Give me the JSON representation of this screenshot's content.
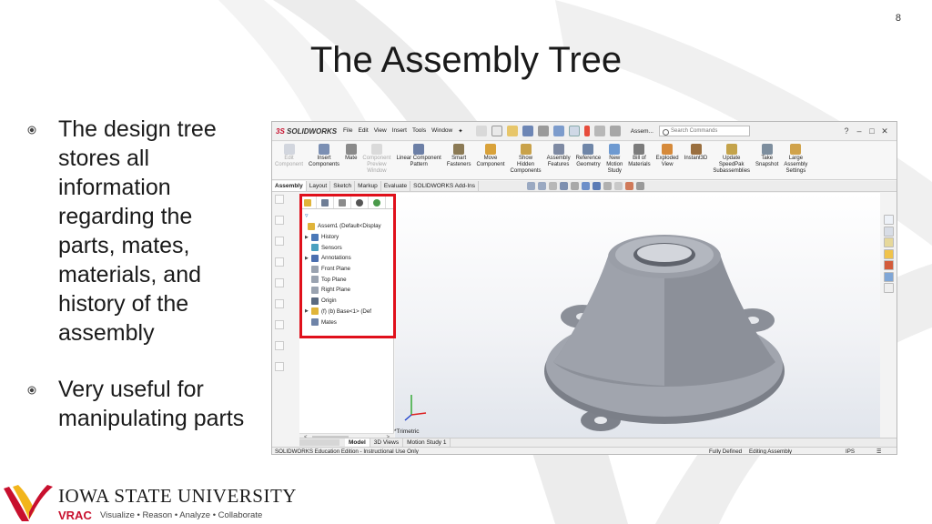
{
  "slide": {
    "page_number": "8",
    "title": "The Assembly Tree",
    "bullets": [
      "The design tree stores all information regarding the parts, mates, materials, and history of the assembly",
      "Very useful for manipulating parts"
    ]
  },
  "logo": {
    "university": "IOWA STATE UNIVERSITY",
    "lab": "VRAC",
    "tagline": "Visualize • Reason • Analyze • Collaborate"
  },
  "solidworks": {
    "brand_prefix": "3S",
    "brand": "SOLIDWORKS",
    "menu": [
      "File",
      "Edit",
      "View",
      "Insert",
      "Tools",
      "Window"
    ],
    "document_name": "Assem...",
    "search_placeholder": "Search Commands",
    "ribbon": [
      {
        "label": "Edit\nComponent",
        "dim": true,
        "color": "#9aa6b8"
      },
      {
        "label": "Insert\nComponents",
        "dim": false,
        "color": "#7b8fb3"
      },
      {
        "label": "Mate",
        "dim": false,
        "color": "#8a8a8a"
      },
      {
        "label": "Component\nPreview\nWindow",
        "dim": true,
        "color": "#b0b0b0"
      },
      {
        "label": "Linear Component\nPattern",
        "dim": false,
        "color": "#6c7fa6"
      },
      {
        "label": "Smart\nFasteners",
        "dim": false,
        "color": "#8b7a55"
      },
      {
        "label": "Move\nComponent",
        "dim": false,
        "color": "#d9a23a"
      },
      {
        "label": "Show\nHidden\nComponents",
        "dim": false,
        "color": "#c9a24a"
      },
      {
        "label": "Assembly\nFeatures",
        "dim": false,
        "color": "#7e8aa3"
      },
      {
        "label": "Reference\nGeometry",
        "dim": false,
        "color": "#6f86a8"
      },
      {
        "label": "New\nMotion\nStudy",
        "dim": false,
        "color": "#6e9ad1"
      },
      {
        "label": "Bill of\nMaterials",
        "dim": false,
        "color": "#7c7c7c"
      },
      {
        "label": "Exploded\nView",
        "dim": false,
        "color": "#d68a3a"
      },
      {
        "label": "Instant3D",
        "dim": false,
        "color": "#9a6f3f"
      },
      {
        "label": "Update\nSpeedPak\nSubassemblies",
        "dim": false,
        "color": "#c4a34a"
      },
      {
        "label": "Take\nSnapshot",
        "dim": false,
        "color": "#7d8e9e"
      },
      {
        "label": "Large\nAssembly\nSettings",
        "dim": false,
        "color": "#d0a24a"
      }
    ],
    "command_tabs": [
      "Assembly",
      "Layout",
      "Sketch",
      "Markup",
      "Evaluate",
      "SOLIDWORKS Add-Ins"
    ],
    "active_command_tab": "Assembly",
    "feature_tree": [
      {
        "arrow": "",
        "icon_color": "#e0b43a",
        "label": "Assem1  (Default<Display"
      },
      {
        "arrow": "▶",
        "icon_color": "#4a78b8",
        "label": "History"
      },
      {
        "arrow": "",
        "icon_color": "#4aa0c0",
        "label": "Sensors"
      },
      {
        "arrow": "▶",
        "icon_color": "#4a6fb0",
        "label": "Annotations"
      },
      {
        "arrow": "",
        "icon_color": "#9aa3b0",
        "label": "Front Plane"
      },
      {
        "arrow": "",
        "icon_color": "#9aa3b0",
        "label": "Top Plane"
      },
      {
        "arrow": "",
        "icon_color": "#9aa3b0",
        "label": "Right Plane"
      },
      {
        "arrow": "",
        "icon_color": "#5a6a80",
        "label": "Origin"
      },
      {
        "arrow": "▶",
        "icon_color": "#e0b43a",
        "label": "(f) (b) Base<1> (Def"
      },
      {
        "arrow": "",
        "icon_color": "#6f84a8",
        "label": "Mates"
      }
    ],
    "view_label": "*Trimetric",
    "bottom_tabs": [
      "Model",
      "3D Views",
      "Motion Study 1"
    ],
    "active_bottom_tab": "Model",
    "status": {
      "left": "SOLIDWORKS Education Edition - Instructional Use Only",
      "defined": "Fully Defined",
      "mode": "Editing Assembly",
      "units": "IPS"
    }
  },
  "colors": {
    "highlight": "#e0101b",
    "accent_red": "#c8102e",
    "part": "#8d919a"
  }
}
